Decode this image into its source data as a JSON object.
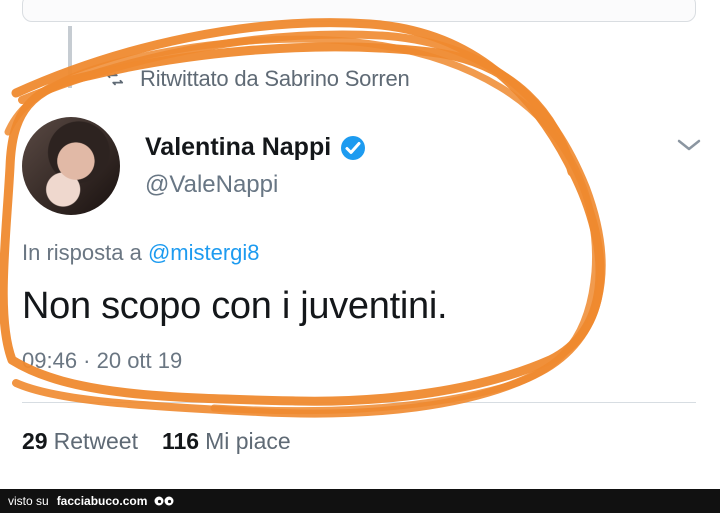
{
  "retweet": {
    "label": "Ritwittato da Sabrino Sorren"
  },
  "user": {
    "name": "Valentina Nappi",
    "handle": "@ValeNappi"
  },
  "reply": {
    "prefix": "In risposta a ",
    "mention": "@mistergi8"
  },
  "tweet": {
    "text": "Non scopo con i juventini.",
    "meta": "09:46 · 20 ott 19"
  },
  "stats": {
    "retweets_count": "29",
    "retweets_label": "Retweet",
    "likes_count": "116",
    "likes_label": "Mi piace"
  },
  "footer": {
    "prefix": "visto su",
    "brand": "facciabuco.com"
  },
  "icons": {
    "retweet": "retweet-icon",
    "verified": "verified-icon",
    "menu": "chevron-down-icon",
    "footer": "face-icon"
  },
  "colors": {
    "accent": "#1d9bf0",
    "annotation": "#ef8a2f"
  }
}
